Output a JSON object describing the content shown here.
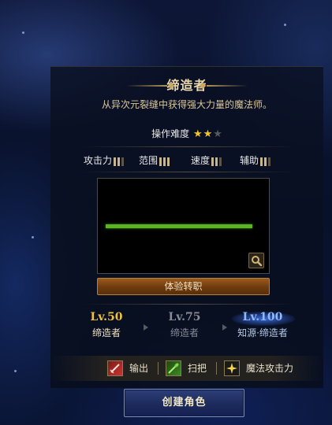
{
  "header": {
    "class_name": "缔造者",
    "description": "从异次元裂缝中获得强大力量的魔法师。"
  },
  "difficulty": {
    "label": "操作难度",
    "stars_filled": 2,
    "stars_total": 3
  },
  "stats": [
    {
      "label": "攻击力",
      "filled": 2,
      "total": 3
    },
    {
      "label": "范围",
      "filled": 3,
      "total": 3
    },
    {
      "label": "速度",
      "filled": 2,
      "total": 3
    },
    {
      "label": "辅助",
      "filled": 2,
      "total": 3
    }
  ],
  "preview": {
    "zoom_icon": "magnifier-icon"
  },
  "actions": {
    "trial_label": "体验转职",
    "create_label": "创建角色"
  },
  "levels": [
    {
      "level": "Lv.50",
      "name": "缔造者",
      "state": "current"
    },
    {
      "level": "Lv.75",
      "name": "缔造者",
      "state": "locked"
    },
    {
      "level": "Lv.100",
      "name": "知源·缔造者",
      "state": "highlight"
    }
  ],
  "skills": [
    {
      "icon": "sword-icon",
      "label": "输出"
    },
    {
      "icon": "broom-icon",
      "label": "扫把"
    },
    {
      "icon": "sparkle-icon",
      "label": "魔法攻击力"
    }
  ],
  "colors": {
    "gold": "#f0c23a",
    "progress_green": "#5bb422",
    "button_brown": "#9b5a1c",
    "button_blue": "#2e3f79",
    "highlight_blue": "#8fb9ff"
  }
}
